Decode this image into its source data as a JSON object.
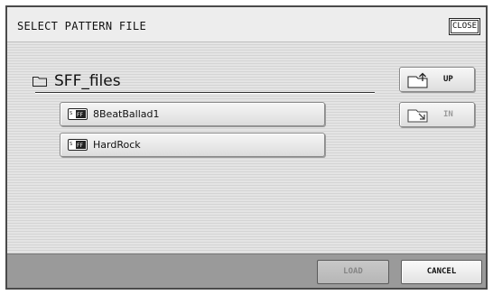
{
  "title": "SELECT PATTERN FILE",
  "close_label": "CLOSE",
  "folder": {
    "name": "SFF_files",
    "icon": "folder-icon"
  },
  "files": [
    {
      "name": "8BeatBallad1",
      "icon": "sff-file-icon"
    },
    {
      "name": "HardRock",
      "icon": "sff-file-icon"
    }
  ],
  "nav": {
    "up_label": "UP",
    "in_label": "IN"
  },
  "footer": {
    "load_label": "LOAD",
    "cancel_label": "CANCEL"
  }
}
